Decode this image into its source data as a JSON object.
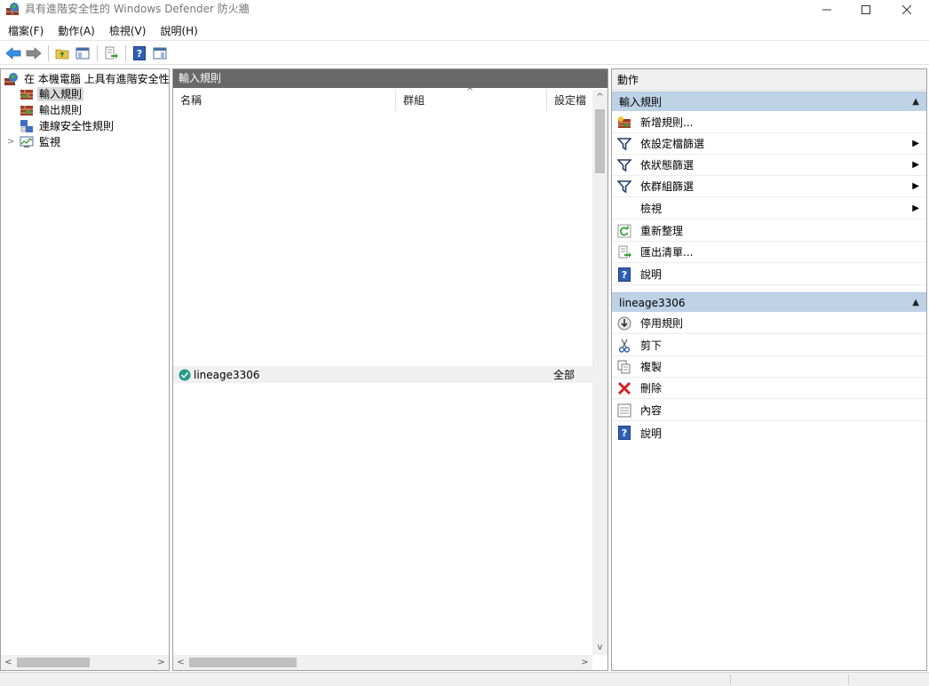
{
  "window": {
    "title": "具有進階安全性的 Windows Defender 防火牆"
  },
  "menu": [
    {
      "label": "檔案(F)"
    },
    {
      "label": "動作(A)"
    },
    {
      "label": "檢視(V)"
    },
    {
      "label": "說明(H)"
    }
  ],
  "tree": {
    "root": "在 本機電腦 上具有進階安全性的",
    "items": [
      {
        "label": "輸入規則"
      },
      {
        "label": "輸出規則"
      },
      {
        "label": "連線安全性規則"
      },
      {
        "label": "監視"
      }
    ]
  },
  "middle": {
    "header": "輸入規則",
    "columns": [
      {
        "label": "名稱"
      },
      {
        "label": "群組"
      },
      {
        "label": "設定檔"
      }
    ],
    "rows": [
      {
        "name": "lineage3306",
        "profile": "全部"
      }
    ]
  },
  "actions": {
    "title": "動作",
    "section1": {
      "header": "輸入規則",
      "items": [
        {
          "label": "新增規則..."
        },
        {
          "label": "依設定檔篩選"
        },
        {
          "label": "依狀態篩選"
        },
        {
          "label": "依群組篩選"
        },
        {
          "label": "檢視"
        },
        {
          "label": "重新整理"
        },
        {
          "label": "匯出清單..."
        },
        {
          "label": "說明"
        }
      ]
    },
    "section2": {
      "header": "lineage3306",
      "items": [
        {
          "label": "停用規則"
        },
        {
          "label": "剪下"
        },
        {
          "label": "複製"
        },
        {
          "label": "刪除"
        },
        {
          "label": "內容"
        },
        {
          "label": "說明"
        }
      ]
    }
  },
  "colors": {
    "pane_header": "#696969",
    "section_header": "#bed2e6",
    "selection": "#d9d9d9"
  }
}
